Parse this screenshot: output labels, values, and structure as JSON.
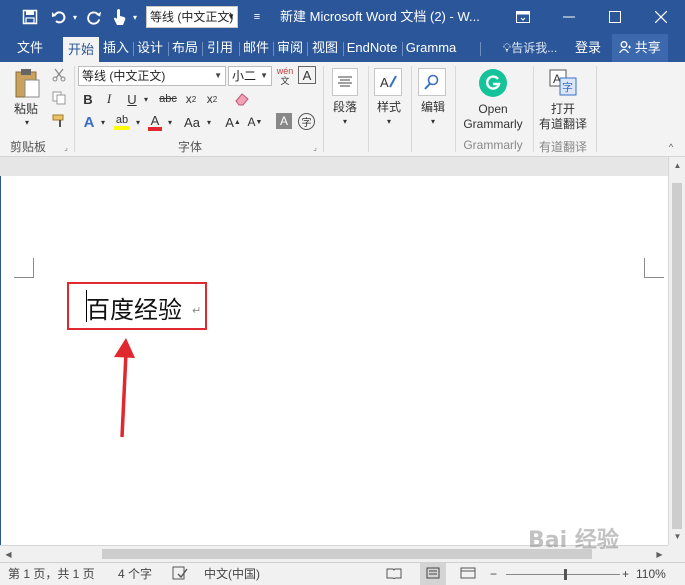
{
  "title_bar": {
    "font_value": "等线 (中文正文)",
    "doc_title": "新建 Microsoft Word 文档 (2) - W...",
    "colors": {
      "brand": "#2b579a",
      "highlight": "#e0282e",
      "grammarly": "#15c39a"
    }
  },
  "tabs": [
    {
      "label": "文件"
    },
    {
      "label": "开始"
    },
    {
      "label": "插入"
    },
    {
      "label": "设计"
    },
    {
      "label": "布局"
    },
    {
      "label": "引用"
    },
    {
      "label": "邮件"
    },
    {
      "label": "审阅"
    },
    {
      "label": "视图"
    },
    {
      "label": "EndNote"
    },
    {
      "label": "Gramma"
    }
  ],
  "tab_right": {
    "tell_me": "告诉我...",
    "login": "登录",
    "share": "共享"
  },
  "ribbon": {
    "clipboard": {
      "paste": "粘贴",
      "group": "剪贴板"
    },
    "font": {
      "font_name": "等线 (中文正文)",
      "font_size": "小二",
      "group": "字体"
    },
    "paragraph": {
      "label": "段落"
    },
    "styles": {
      "label": "样式"
    },
    "editing": {
      "label": "编辑"
    },
    "grammarly": {
      "open": "Open",
      "name": "Grammarly",
      "group": "Grammarly"
    },
    "youdao": {
      "open": "打开",
      "name": "有道翻译",
      "group": "有道翻译"
    }
  },
  "document": {
    "text": "百度经验"
  },
  "status": {
    "page": "第 1 页，共 1 页",
    "words": "4 个字",
    "language": "中文(中国)",
    "zoom": "110%"
  },
  "watermark": "Bai 经验"
}
